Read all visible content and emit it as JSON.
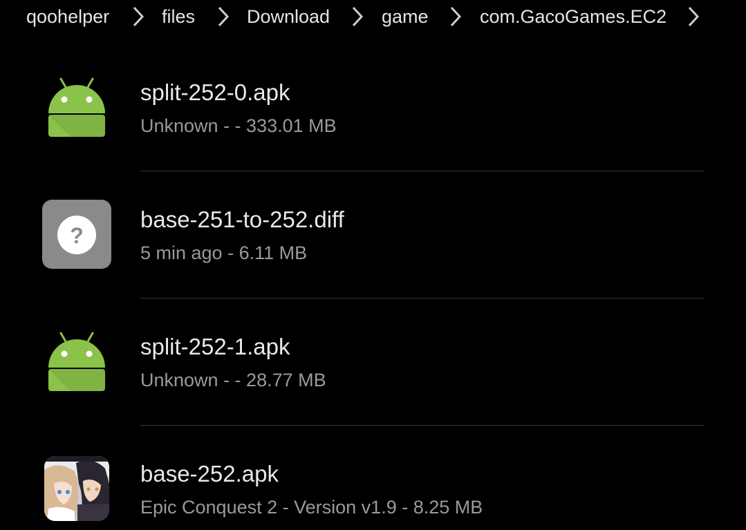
{
  "breadcrumb": {
    "items": [
      {
        "label": "qoohelper"
      },
      {
        "label": "files"
      },
      {
        "label": "Download"
      },
      {
        "label": "game"
      },
      {
        "label": "com.GacoGames.EC2"
      }
    ],
    "separator_icon": "chevron-right-icon"
  },
  "files": [
    {
      "name": "split-252-0.apk",
      "meta": "Unknown -  - 333.01 MB",
      "icon": "android-apk-icon"
    },
    {
      "name": "base-251-to-252.diff",
      "meta": "5 min ago - 6.11 MB",
      "icon": "unknown-file-icon"
    },
    {
      "name": "split-252-1.apk",
      "meta": "Unknown -  - 28.77 MB",
      "icon": "android-apk-icon"
    },
    {
      "name": "base-252.apk",
      "meta": "Epic Conquest 2 - Version v1.9 - 8.25 MB",
      "icon": "epic-conquest-app-icon"
    }
  ],
  "colors": {
    "background": "#000000",
    "primary_text": "#e8e8e8",
    "secondary_text": "#9a9a9a",
    "android_green": "#8bc34a",
    "divider": "#3a3a3a"
  }
}
